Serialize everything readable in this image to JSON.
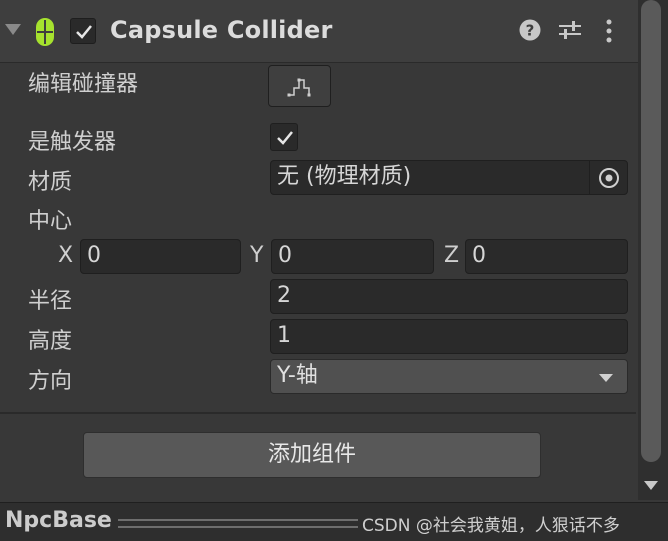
{
  "header": {
    "title": "Capsule Collider",
    "enabled": true,
    "icons": [
      "foldout-arrow",
      "capsule-collider-icon",
      "help-icon",
      "presets-icon",
      "more-menu-icon"
    ]
  },
  "fields": {
    "edit_collider": {
      "label": "编辑碰撞器",
      "icon": "edit-collider-icon"
    },
    "is_trigger": {
      "label": "是触发器",
      "checked": true
    },
    "material": {
      "label": "材质",
      "value": "无 (物理材质)",
      "icon": "object-picker-icon"
    },
    "center": {
      "label": "中心",
      "x_label": "X",
      "x": "0",
      "y_label": "Y",
      "y": "0",
      "z_label": "Z",
      "z": "0"
    },
    "radius": {
      "label": "半径",
      "value": "2"
    },
    "height": {
      "label": "高度",
      "value": "1"
    },
    "direction": {
      "label": "方向",
      "value": "Y-轴"
    }
  },
  "add_component": {
    "label": "添加组件"
  },
  "bottom": {
    "title": "NpcBase",
    "watermark": "CSDN @社会我黄姐，人狠话不多"
  },
  "colors": {
    "background": "#383838",
    "field_bg": "#2a2a2a",
    "capsule_icon": "#a6e22e",
    "button_bg": "#585858"
  }
}
